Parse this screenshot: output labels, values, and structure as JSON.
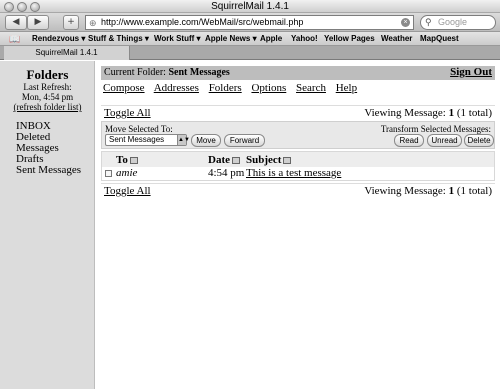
{
  "browser": {
    "window_title": "SquirrelMail 1.4.1",
    "url": "http://www.example.com/WebMail/src/webmail.php",
    "search_placeholder": "Google",
    "bookmarks": [
      "Rendezvous ▾",
      "Stuff & Things ▾",
      "Work Stuff ▾",
      "Apple News ▾",
      "Apple",
      "Yahoo!",
      "Yellow Pages",
      "Weather",
      "MapQuest"
    ],
    "tab_title": "SquirrelMail 1.4.1",
    "icons": {
      "back": "back-arrow-icon",
      "forward": "forward-arrow-icon",
      "new_tab": "plus-icon",
      "bookmarks": "book-icon",
      "stop": "stop-icon",
      "search": "magnifier-icon"
    }
  },
  "sidebar": {
    "title": "Folders",
    "last_refresh_label": "Last Refresh:",
    "last_refresh_time": "Mon, 4:54 pm",
    "refresh_link": "(refresh folder list)",
    "folders": [
      "INBOX",
      "Deleted Messages",
      "Drafts",
      "Sent Messages"
    ]
  },
  "header": {
    "current_folder_label": "Current Folder:",
    "current_folder": "Sent Messages",
    "sign_out": "Sign Out"
  },
  "menu": [
    "Compose",
    "Addresses",
    "Folders",
    "Options",
    "Search",
    "Help"
  ],
  "list": {
    "toggle_all": "Toggle All",
    "viewing_prefix": "Viewing Message:",
    "viewing_num": "1",
    "viewing_total": "(1 total)"
  },
  "actions": {
    "move_selected_label": "Move Selected To:",
    "move_target": "Sent Messages",
    "move_button": "Move",
    "forward_button": "Forward",
    "transform_label": "Transform Selected Messages:",
    "read_button": "Read",
    "unread_button": "Unread",
    "delete_button": "Delete"
  },
  "table": {
    "headers": {
      "to": "To",
      "date": "Date",
      "subject": "Subject"
    },
    "rows": [
      {
        "to": "amie",
        "date": "4:54 pm",
        "subject": "This is a test message"
      }
    ]
  }
}
